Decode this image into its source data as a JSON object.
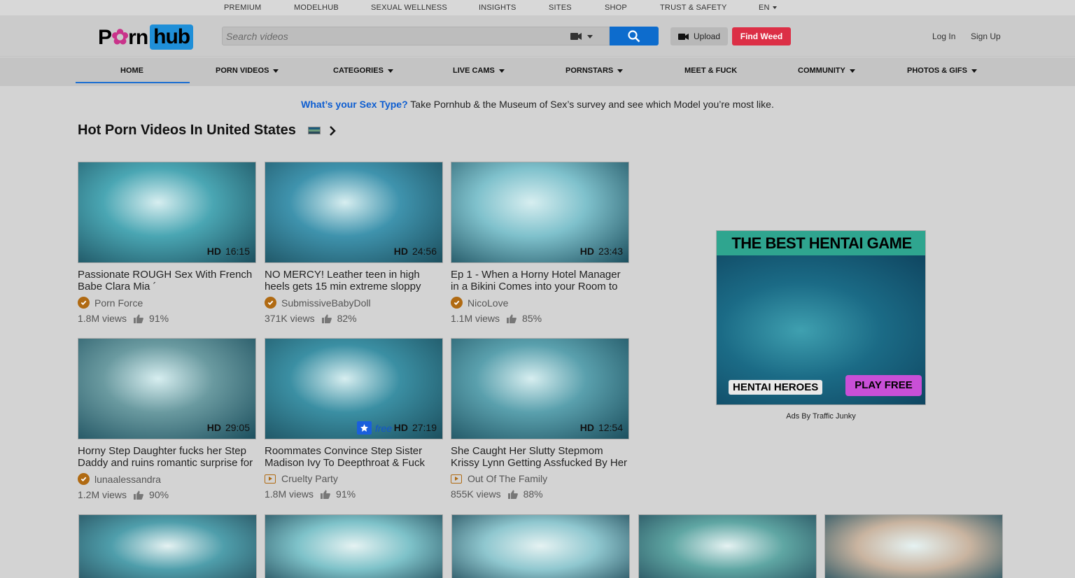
{
  "top_links": [
    {
      "label": "PREMIUM"
    },
    {
      "label": "MODELHUB"
    },
    {
      "label": "SEXUAL WELLNESS"
    },
    {
      "label": "INSIGHTS"
    },
    {
      "label": "SITES"
    },
    {
      "label": "SHOP"
    },
    {
      "label": "TRUST & SAFETY"
    },
    {
      "label": "EN"
    }
  ],
  "logo": {
    "part1": "P",
    "part1b": "rn",
    "part2": "hub"
  },
  "search": {
    "placeholder": "Search videos"
  },
  "header": {
    "upload_label": "Upload",
    "find_weed_label": "Find Weed",
    "login_label": "Log In",
    "signup_label": "Sign Up"
  },
  "nav": [
    {
      "label": "HOME",
      "active": true
    },
    {
      "label": "PORN VIDEOS",
      "dropdown": true
    },
    {
      "label": "CATEGORIES",
      "dropdown": true
    },
    {
      "label": "LIVE CAMS",
      "dropdown": true
    },
    {
      "label": "PORNSTARS",
      "dropdown": true
    },
    {
      "label": "MEET & FUCK"
    },
    {
      "label": "COMMUNITY",
      "dropdown": true
    },
    {
      "label": "PHOTOS & GIFS",
      "dropdown": true
    }
  ],
  "promo": {
    "link_text": "What’s your Sex Type?",
    "text": " Take Pornhub & the Museum of Sex’s survey and see which Model you’re most like."
  },
  "section": {
    "title": "Hot Porn Videos In United States"
  },
  "videos": [
    {
      "title": "Passionate ROUGH Sex With French Babe Clara Mia ´",
      "uploader": "Porn Force",
      "uploader_type": "verified",
      "views": "1.8M views",
      "rating": "91%",
      "hd": "HD",
      "duration": "16:15",
      "tint": "#4aa6b3"
    },
    {
      "title": "NO MERCY! Leather teen in high heels gets 15 min extreme sloppy",
      "uploader": "SubmissiveBabyDoll",
      "uploader_type": "verified",
      "views": "371K views",
      "rating": "82%",
      "hd": "HD",
      "duration": "24:56",
      "tint": "#3f93ad"
    },
    {
      "title": "Ep 1 - When a Horny Hotel Manager in a Bikini Comes into your Room to",
      "uploader": "NicoLove",
      "uploader_type": "verified",
      "views": "1.1M views",
      "rating": "85%",
      "hd": "HD",
      "duration": "23:43",
      "tint": "#7fc1cc"
    },
    {
      "title": "Horny Step Daughter fucks her Step Daddy and ruins romantic surprise for",
      "uploader": "lunaalessandra",
      "uploader_type": "verified",
      "views": "1.2M views",
      "rating": "90%",
      "hd": "HD",
      "duration": "29:05",
      "tint": "#6a9aa0"
    },
    {
      "title": "Roommates Convince Step Sister Madison Ivy To Deepthroat & Fuck",
      "uploader": "Cruelty Party",
      "uploader_type": "channel",
      "views": "1.8M views",
      "rating": "91%",
      "hd": "HD",
      "duration": "27:19",
      "free": "free",
      "tint": "#3b8fa3"
    },
    {
      "title": "She Caught Her Slutty Stepmom Krissy Lynn Getting Assfucked By Her",
      "uploader": "Out Of The Family",
      "uploader_type": "channel",
      "views": "855K views",
      "rating": "88%",
      "hd": "HD",
      "duration": "12:54",
      "tint": "#5aa0ad"
    }
  ],
  "bottom_thumbs": [
    {
      "tint": "#4f9eab"
    },
    {
      "tint": "#7ec2c9"
    },
    {
      "tint": "#8fc7cf"
    },
    {
      "tint": "#5fa6a3"
    },
    {
      "tint": "#c9b4a0"
    }
  ],
  "ad": {
    "headline": "THE BEST HENTAI GAME",
    "brand": "HENTAI HEROES",
    "cta": "PLAY FREE",
    "label": "Ads By Traffic Junky"
  }
}
